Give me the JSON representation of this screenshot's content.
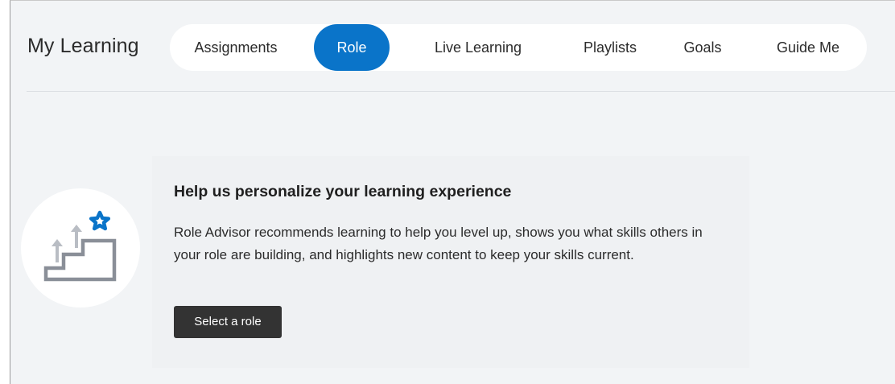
{
  "header": {
    "title": "My Learning",
    "tabs": [
      {
        "label": "Assignments",
        "active": false
      },
      {
        "label": "Role",
        "active": true
      },
      {
        "label": "Live Learning",
        "active": false
      },
      {
        "label": "Playlists",
        "active": false
      },
      {
        "label": "Goals",
        "active": false
      },
      {
        "label": "Guide Me",
        "active": false
      }
    ]
  },
  "promo": {
    "illustration_icon": "stairs-with-star-icon",
    "heading": "Help us personalize your learning experience",
    "body": "Role Advisor recommends learning to help you level up, shows you what skills others in your role are building, and highlights new content to keep your skills current.",
    "button_label": "Select a role"
  },
  "colors": {
    "accent": "#0a74c9",
    "button_dark": "#333333",
    "background": "#f2f4f6"
  }
}
